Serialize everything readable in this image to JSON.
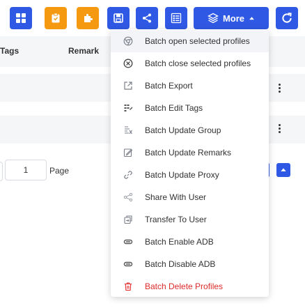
{
  "toolbar": {
    "buttons": [
      {
        "name": "grid-apps-icon"
      },
      {
        "name": "clipboard-icon"
      },
      {
        "name": "puzzle-icon"
      },
      {
        "name": "save-disk-icon"
      },
      {
        "name": "share-icon"
      },
      {
        "name": "list-view-icon"
      }
    ],
    "more_label": "More",
    "colors": {
      "blue": "#2f59e5",
      "orange": "#f59a10",
      "danger": "#e02a2a"
    }
  },
  "table": {
    "columns": [
      "Tags",
      "Remark"
    ]
  },
  "pagination": {
    "page_value": "1",
    "page_label": "Page"
  },
  "dropdown": {
    "items": [
      {
        "label": "Batch open selected profiles",
        "icon": "chrome-icon"
      },
      {
        "label": "Batch close selected profiles",
        "icon": "close-circle-icon"
      },
      {
        "label": "Batch Export",
        "icon": "export-icon"
      },
      {
        "label": "Batch Edit Tags",
        "icon": "tags-icon"
      },
      {
        "label": "Batch Update Group",
        "icon": "group-icon"
      },
      {
        "label": "Batch Update Remarks",
        "icon": "edit-icon"
      },
      {
        "label": "Batch Update Proxy",
        "icon": "link-icon"
      },
      {
        "label": "Share With User",
        "icon": "share-icon"
      },
      {
        "label": "Transfer To User",
        "icon": "transfer-icon"
      },
      {
        "label": "Batch Enable ADB",
        "icon": "adb-icon"
      },
      {
        "label": "Batch Disable ADB",
        "icon": "adb-icon"
      },
      {
        "label": "Batch Delete Profiles",
        "icon": "trash-icon"
      }
    ]
  }
}
